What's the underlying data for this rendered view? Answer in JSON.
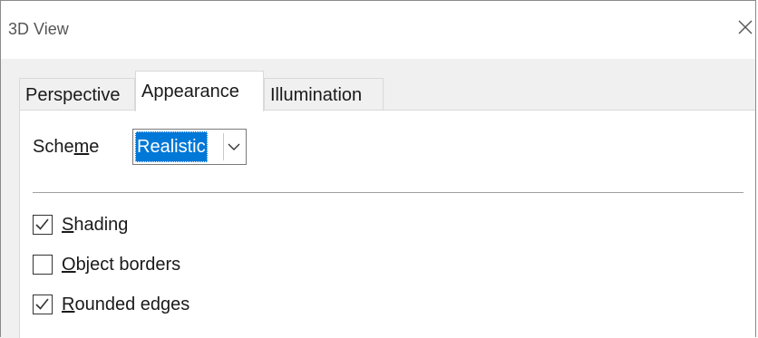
{
  "window": {
    "title": "3D View",
    "close_icon": "close-icon"
  },
  "tabs": [
    {
      "label": "Perspective",
      "active": false
    },
    {
      "label": "Appearance",
      "active": true
    },
    {
      "label": "Illumination",
      "active": false
    }
  ],
  "scheme": {
    "label_pre": "Sche",
    "label_mnemonic": "m",
    "label_post": "e",
    "value": "Realistic",
    "arrow_icon": "chevron-down-icon"
  },
  "options": [
    {
      "mnemonic": "S",
      "rest": "hading",
      "checked": true
    },
    {
      "mnemonic": "O",
      "rest": "bject borders",
      "checked": false
    },
    {
      "mnemonic": "R",
      "rest": "ounded edges",
      "checked": true
    }
  ],
  "colors": {
    "selection": "#0078d7",
    "client_background": "#f0f0f0"
  }
}
